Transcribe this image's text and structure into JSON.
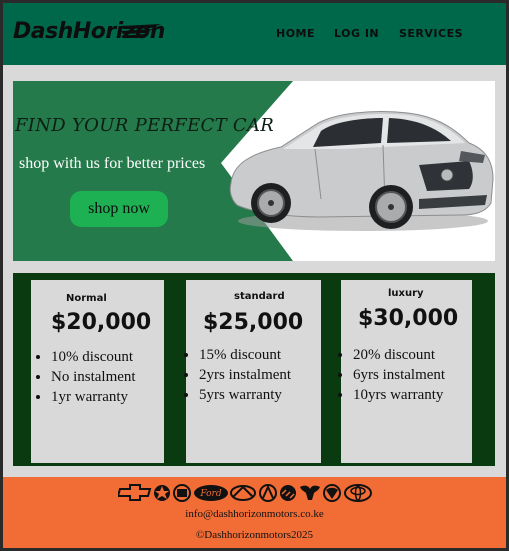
{
  "header": {
    "logo": "DashHorizon",
    "nav": [
      "HOME",
      "LOG IN",
      "SERVICES"
    ]
  },
  "hero": {
    "title": "FIND YOUR PERFECT CAR",
    "subtitle": "shop with us for better prices",
    "button": "shop now"
  },
  "plans": [
    {
      "tier": "Normal",
      "price": "$20,000",
      "features": [
        "10% discount",
        "No instalment",
        "1yr warranty"
      ]
    },
    {
      "tier": "standard",
      "price": "$25,000",
      "features": [
        "15% discount",
        "2yrs instalment",
        "5yrs warranty"
      ]
    },
    {
      "tier": "luxury",
      "price": "$30,000",
      "features": [
        "20% discount",
        "6yrs instalment",
        "10yrs warranty"
      ]
    }
  ],
  "footer": {
    "brand_logos": [
      "chevrolet-logo",
      "chrysler-logo",
      "cadillac-logo",
      "ford-logo",
      "infiniti-logo",
      "acura-logo",
      "buick-logo",
      "dodge-logo",
      "ram-logo",
      "toyota-logo"
    ],
    "email": "info@dashhorizonmotors.co.ke",
    "copyright": "©Dashhorizonmotors2025"
  },
  "colors": {
    "header_green": "#00684a",
    "hero_green": "#247a4a",
    "button_green": "#1db153",
    "pricing_bg": "#0a3a10",
    "footer_orange": "#f26c35",
    "page_bg": "#d9d9d9"
  }
}
